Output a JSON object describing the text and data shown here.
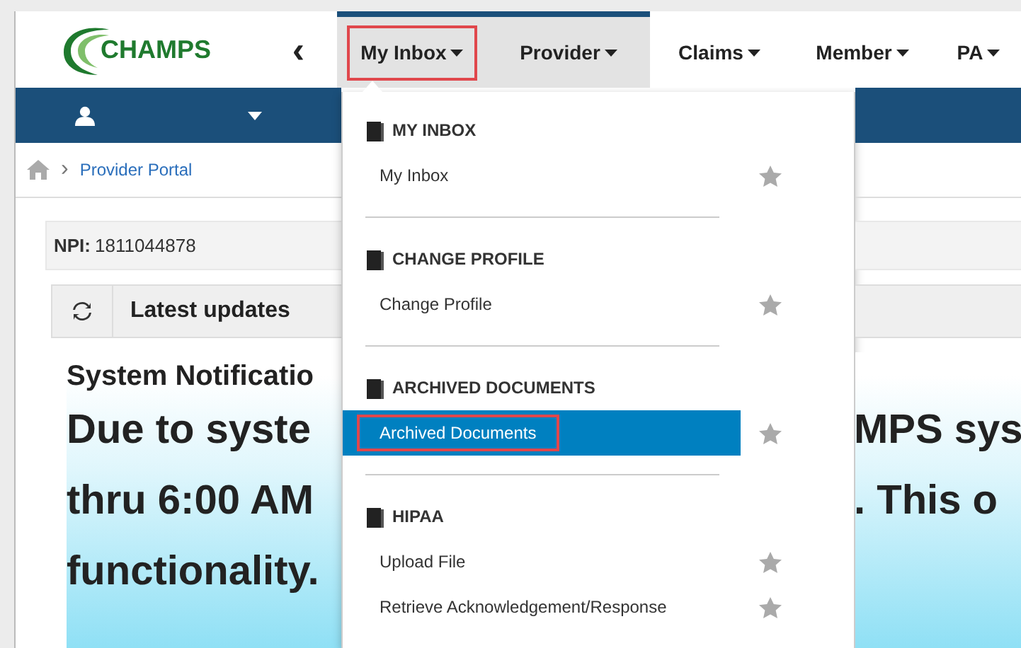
{
  "logo": {
    "text": "CHAMPS"
  },
  "nav": {
    "collapse_glyph": "‹",
    "tabs": [
      {
        "label": "My Inbox",
        "selected": true,
        "hovered": false,
        "highlighted": true
      },
      {
        "label": "Provider",
        "selected": false,
        "hovered": true,
        "highlighted": false
      },
      {
        "label": "Claims",
        "selected": false,
        "hovered": false,
        "highlighted": false
      },
      {
        "label": "Member",
        "selected": false,
        "hovered": false,
        "highlighted": false
      },
      {
        "label": "PA",
        "selected": false,
        "hovered": false,
        "highlighted": false
      }
    ]
  },
  "breadcrumb": {
    "separator": "›",
    "current": "Provider Portal"
  },
  "npi": {
    "label": "NPI:",
    "value": "1811044878"
  },
  "panel": {
    "title": "Latest updates"
  },
  "notice": {
    "title": "System Notificatio",
    "lines_left": [
      "Due to syste",
      "thru 6:00 AM",
      "functionality."
    ],
    "lines_right": [
      "MPS sys",
      ". This o"
    ]
  },
  "menu": {
    "sections": [
      {
        "title": "MY INBOX",
        "items": [
          {
            "label": "My Inbox",
            "selected": false,
            "highlighted": false
          }
        ]
      },
      {
        "title": "CHANGE PROFILE",
        "items": [
          {
            "label": "Change Profile",
            "selected": false,
            "highlighted": false
          }
        ]
      },
      {
        "title": "ARCHIVED DOCUMENTS",
        "items": [
          {
            "label": "Archived Documents",
            "selected": true,
            "highlighted": true
          }
        ]
      },
      {
        "title": "HIPAA",
        "items": [
          {
            "label": "Upload File",
            "selected": false,
            "highlighted": false
          },
          {
            "label": "Retrieve Acknowledgement/Response",
            "selected": false,
            "highlighted": false
          }
        ]
      }
    ]
  }
}
